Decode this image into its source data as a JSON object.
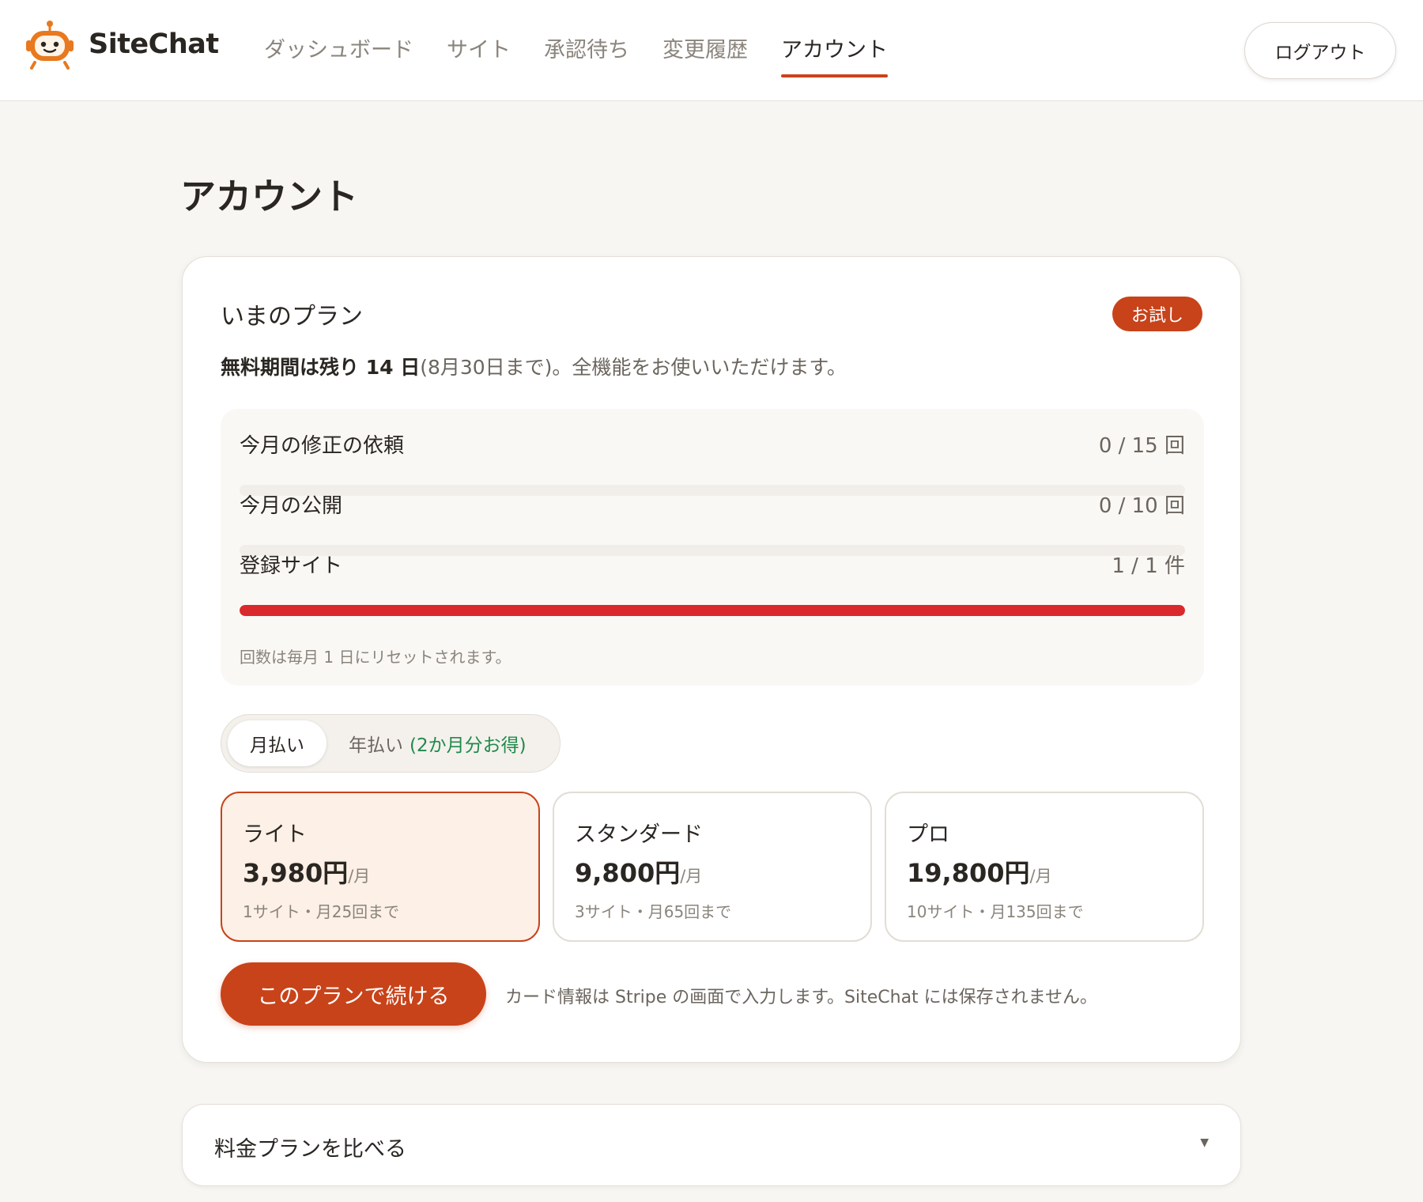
{
  "app": {
    "name": "SiteChat",
    "accent": "#c8431a"
  },
  "nav": {
    "items": [
      {
        "label": "ダッシュボード"
      },
      {
        "label": "サイト"
      },
      {
        "label": "承認待ち"
      },
      {
        "label": "変更履歴"
      },
      {
        "label": "アカウント",
        "active": true
      }
    ],
    "logout_label": "ログアウト"
  },
  "page": {
    "title": "アカウント"
  },
  "plan_card": {
    "title": "いまのプラン",
    "badge": "お試し",
    "trial_strong": "無料期間は残り 14 日",
    "trial_rest": "(8月30日まで)。全機能をお使いいただけます。",
    "usage": [
      {
        "label": "今月の修正の依頼",
        "value": "0 / 15 回",
        "fraction": 0
      },
      {
        "label": "今月の公開",
        "value": "0 / 10 回",
        "fraction": 0
      },
      {
        "label": "登録サイト",
        "value": "1 / 1 件",
        "fraction": 1
      }
    ],
    "usage_note": "回数は毎月 1 日にリセットされます。",
    "bar_color": "#d9292c",
    "billing": {
      "monthly": "月払い",
      "yearly": "年払い",
      "yearly_save": "(2か月分お得)",
      "selected": "monthly"
    },
    "plans": [
      {
        "name": "ライト",
        "price": "3,980円",
        "per": "/月",
        "desc": "1サイト・月25回まで",
        "selected": true
      },
      {
        "name": "スタンダード",
        "price": "9,800円",
        "per": "/月",
        "desc": "3サイト・月65回まで",
        "selected": false
      },
      {
        "name": "プロ",
        "price": "19,800円",
        "per": "/月",
        "desc": "10サイト・月135回まで",
        "selected": false
      }
    ],
    "cta_label": "このプランで続ける",
    "cta_note": "カード情報は Stripe の画面で入力します。SiteChat には保存されません。"
  },
  "compare": {
    "title": "料金プランを比べる",
    "caret_icon": "caret-down-icon"
  }
}
